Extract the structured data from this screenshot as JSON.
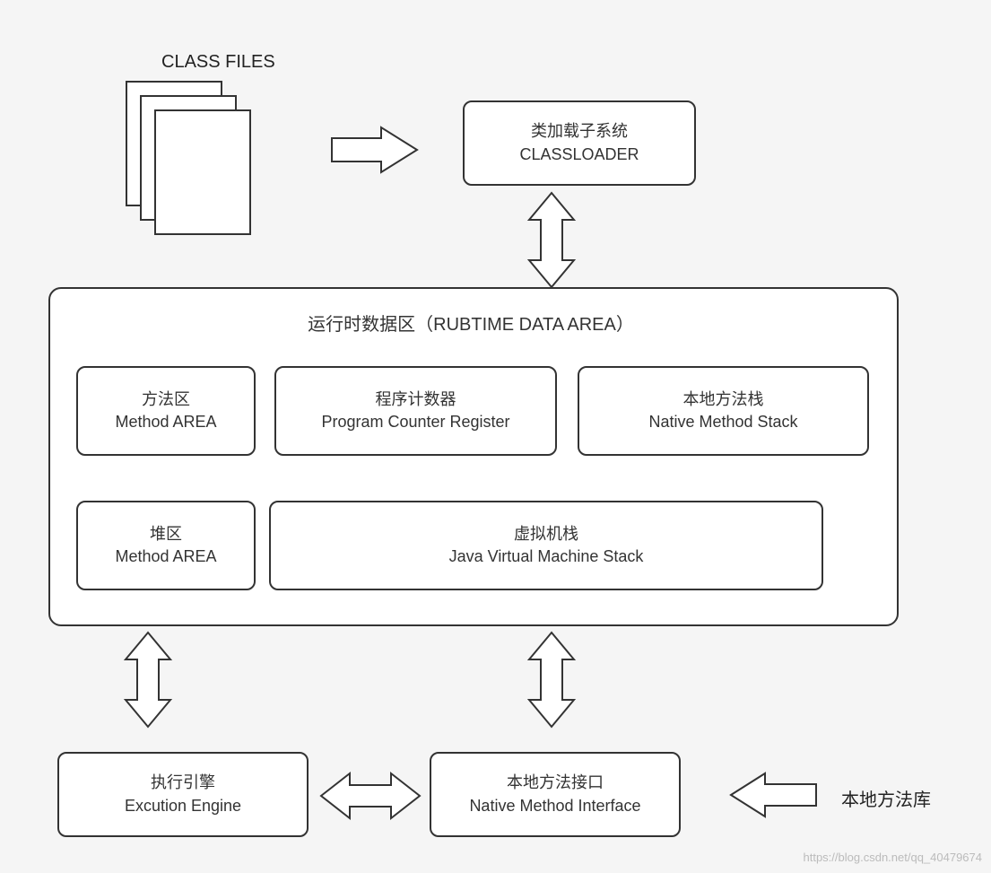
{
  "top": {
    "class_files_label": "CLASS FILES",
    "classloader_cn": "类加载子系统",
    "classloader_en": "CLASSLOADER"
  },
  "runtime_area": {
    "title": "运行时数据区（RUBTIME DATA AREA）",
    "method_area_cn": "方法区",
    "method_area_en": "Method AREA",
    "pc_register_cn": "程序计数器",
    "pc_register_en": "Program Counter Register",
    "native_stack_cn": "本地方法栈",
    "native_stack_en": "Native Method Stack",
    "heap_cn": "堆区",
    "heap_en": "Method AREA",
    "jvm_stack_cn": "虚拟机栈",
    "jvm_stack_en": "Java Virtual Machine Stack"
  },
  "bottom": {
    "exec_engine_cn": "执行引擎",
    "exec_engine_en": "Excution Engine",
    "native_interface_cn": "本地方法接口",
    "native_interface_en": "Native Method Interface",
    "native_lib_label": "本地方法库"
  },
  "watermark": "https://blog.csdn.net/qq_40479674"
}
